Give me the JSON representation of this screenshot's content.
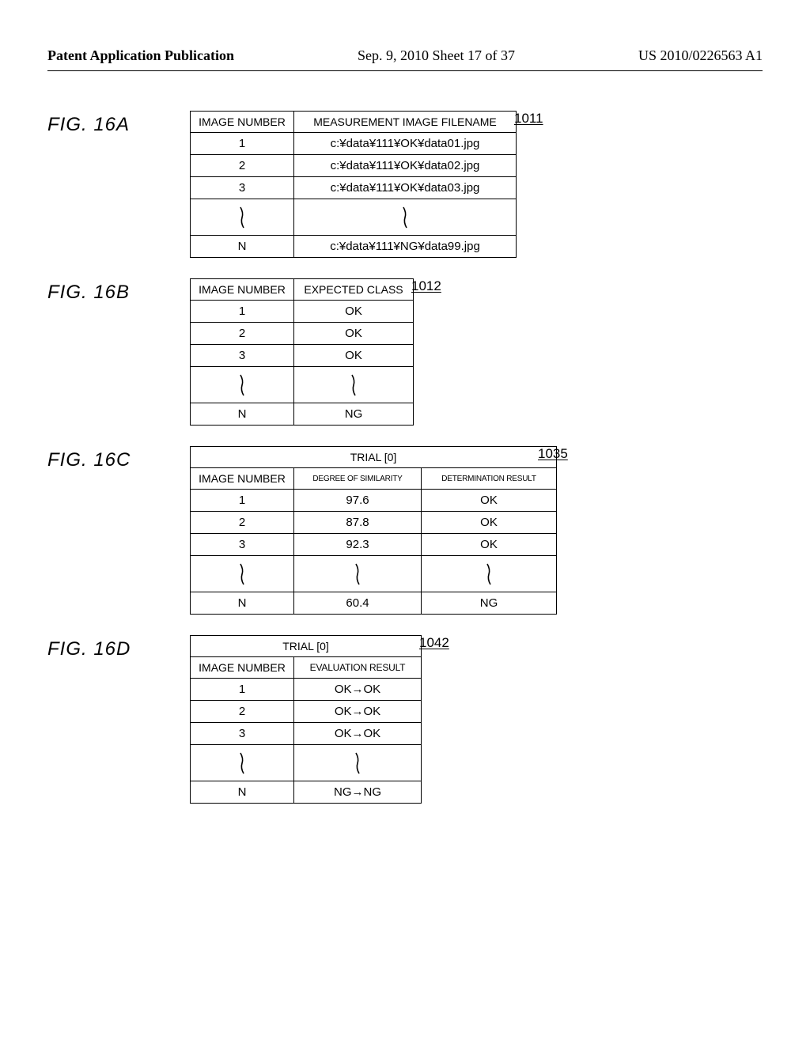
{
  "header": {
    "left": "Patent Application Publication",
    "mid": "Sep. 9, 2010  Sheet 17 of 37",
    "right": "US 2010/0226563 A1"
  },
  "figA": {
    "label": "FIG. 16A",
    "ref": "1011",
    "headers": {
      "c1": "IMAGE NUMBER",
      "c2": "MEASUREMENT IMAGE FILENAME"
    },
    "rows": [
      {
        "n": "1",
        "v": "c:¥data¥111¥OK¥data01.jpg"
      },
      {
        "n": "2",
        "v": "c:¥data¥111¥OK¥data02.jpg"
      },
      {
        "n": "3",
        "v": "c:¥data¥111¥OK¥data03.jpg"
      }
    ],
    "last": {
      "n": "N",
      "v": "c:¥data¥111¥NG¥data99.jpg"
    }
  },
  "figB": {
    "label": "FIG. 16B",
    "ref": "1012",
    "headers": {
      "c1": "IMAGE NUMBER",
      "c2": "EXPECTED CLASS"
    },
    "rows": [
      {
        "n": "1",
        "v": "OK"
      },
      {
        "n": "2",
        "v": "OK"
      },
      {
        "n": "3",
        "v": "OK"
      }
    ],
    "last": {
      "n": "N",
      "v": "NG"
    }
  },
  "figC": {
    "label": "FIG. 16C",
    "ref": "1035",
    "title": "TRIAL [0]",
    "headers": {
      "c1": "IMAGE NUMBER",
      "c2": "DEGREE OF SIMILARITY",
      "c3": "DETERMINATION RESULT"
    },
    "rows": [
      {
        "n": "1",
        "v1": "97.6",
        "v2": "OK"
      },
      {
        "n": "2",
        "v1": "87.8",
        "v2": "OK"
      },
      {
        "n": "3",
        "v1": "92.3",
        "v2": "OK"
      }
    ],
    "last": {
      "n": "N",
      "v1": "60.4",
      "v2": "NG"
    }
  },
  "figD": {
    "label": "FIG. 16D",
    "ref": "1042",
    "title": "TRIAL [0]",
    "headers": {
      "c1": "IMAGE NUMBER",
      "c2": "EVALUATION RESULT"
    },
    "rows": [
      {
        "n": "1",
        "v": "OK→OK"
      },
      {
        "n": "2",
        "v": "OK→OK"
      },
      {
        "n": "3",
        "v": "OK→OK"
      }
    ],
    "last": {
      "n": "N",
      "v": "NG→NG"
    }
  }
}
